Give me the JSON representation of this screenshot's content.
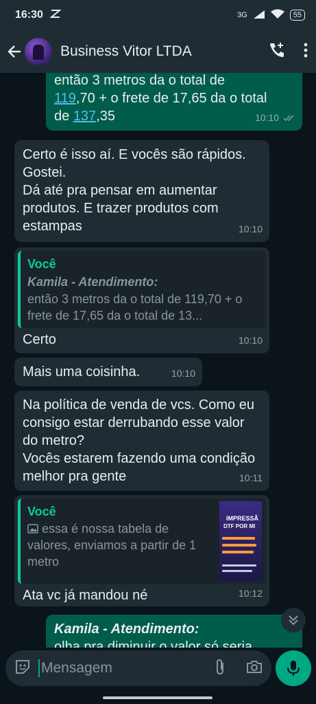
{
  "status": {
    "time": "16:30",
    "network": "3G",
    "battery": "55"
  },
  "header": {
    "contact_name": "Business Vitor LTDA"
  },
  "messages": [
    {
      "dir": "out",
      "lines": [
        "então 3 metros da o total de",
        "119",
        ",70 + o frete de 17,65 da o total",
        "de ",
        "137",
        ",35"
      ],
      "time": "10:10"
    },
    {
      "dir": "in",
      "text": "Certo é isso aí. E vocês são rápidos. Gostei.",
      "text2": "Dá até pra pensar em aumentar produtos. E trazer produtos com estampas",
      "time": "10:10"
    },
    {
      "dir": "in",
      "quote_author": "Você",
      "quote_sub": "Kamila - Atendimento:",
      "quote_text": "então 3 metros da o total de 119,70 + o frete de 17,65 da o total de 13...",
      "text": "Certo",
      "time": "10:10"
    },
    {
      "dir": "in",
      "text": "Mais uma coisinha.",
      "time": "10:10"
    },
    {
      "dir": "in",
      "text": "Na política de venda de vcs. Como eu consigo estar derrubando esse valor do metro?",
      "text2": "Vocês estarem fazendo uma condição melhor pra gente",
      "time": "10:11"
    },
    {
      "dir": "in",
      "quote_author": "Você",
      "quote_text": "essa é nossa tabela de valores, enviamos a partir de 1 metro",
      "thumb_title": "IMPRESSÃ",
      "thumb_sub": "DTF POR MI",
      "text": "Ata vc já mandou né",
      "time": "10:12"
    },
    {
      "dir": "out",
      "author": "Kamila - Atendimento:",
      "text": "olha pra diminuir o valor só seria"
    }
  ],
  "input": {
    "placeholder": "Mensagem"
  },
  "colors": {
    "accent": "#00a884",
    "outgoing": "#005c4b",
    "incoming": "#202c33",
    "link": "#53bdeb"
  }
}
